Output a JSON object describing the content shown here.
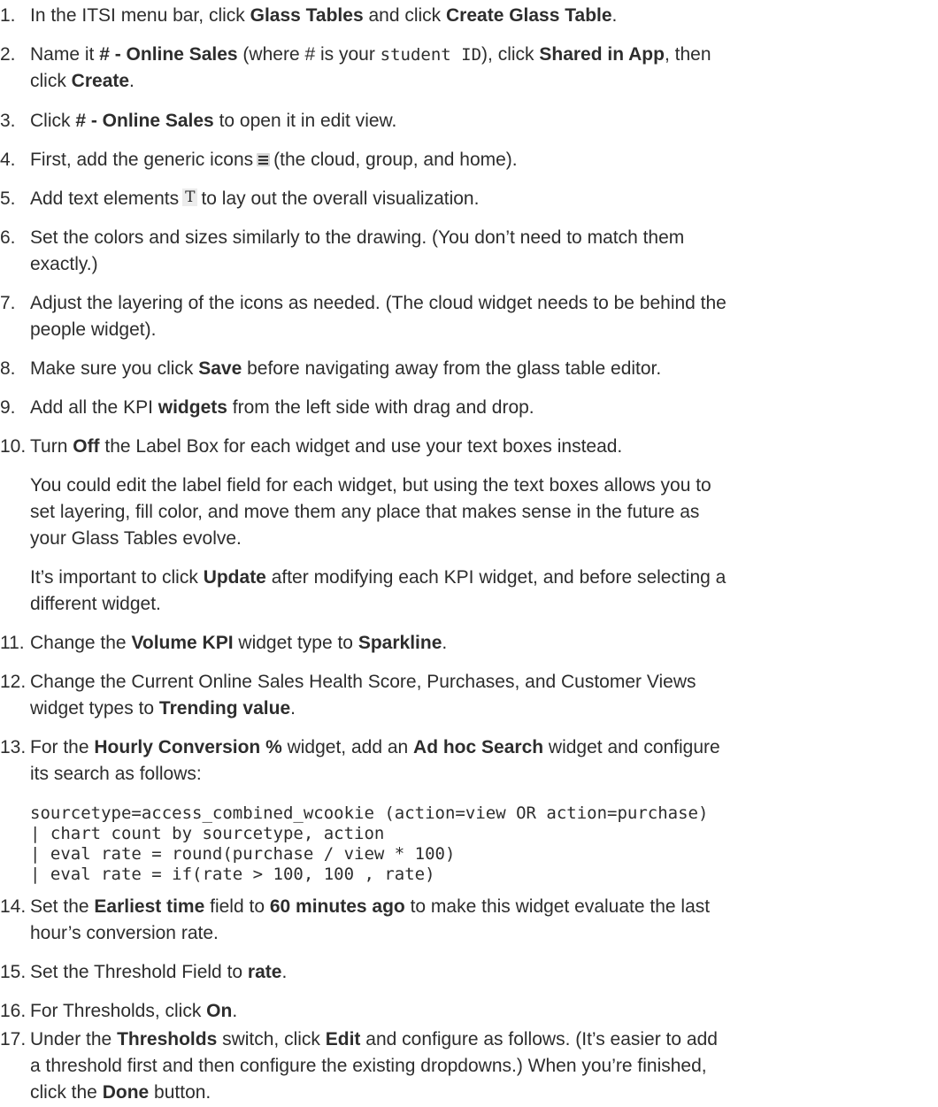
{
  "steps": [
    {
      "n": "1.",
      "parts": [
        "In the ITSI menu bar, click ",
        "Glass Tables",
        " and click ",
        "Create Glass Table",
        "."
      ]
    },
    {
      "n": "2.",
      "line1": [
        "Name it ",
        "# - Online Sales",
        " (where # is your ",
        "student ID",
        "), click ",
        "Shared in App",
        ", then"
      ],
      "line2": [
        "click ",
        "Create",
        "."
      ]
    },
    {
      "n": "3.",
      "parts": [
        "Click ",
        "# - Online Sales",
        " to open it in edit view."
      ]
    },
    {
      "n": "4.",
      "parts": [
        "First, add the generic icons",
        "(the cloud, group, and home)."
      ],
      "icon": "list-icon"
    },
    {
      "n": "5.",
      "parts": [
        "Add text elements",
        "to lay out the overall visualization."
      ],
      "icon": "text-tool-icon",
      "icon_glyph": "T"
    },
    {
      "n": "6.",
      "line1": "Set the colors and sizes similarly to the drawing. (You don’t need to match them",
      "line2": "exactly.)"
    },
    {
      "n": "7.",
      "line1": "Adjust the layering of the icons as needed. (The cloud widget needs to be behind the",
      "line2": "people widget)."
    },
    {
      "n": "8.",
      "parts": [
        "Make sure you click ",
        "Save",
        " before navigating away from the glass table editor."
      ]
    },
    {
      "n": "9.",
      "parts": [
        "Add all the KPI ",
        "widgets",
        " from the left side with drag and drop."
      ]
    },
    {
      "n": "10.",
      "parts": [
        "Turn ",
        "Off",
        " the Label Box for each widget and use your text boxes instead."
      ]
    },
    {
      "n": "11.",
      "parts": [
        "Change the ",
        "Volume KPI",
        " widget type to ",
        "Sparkline",
        "."
      ]
    },
    {
      "n": "12.",
      "line1": "Change the Current Online Sales Health Score, Purchases, and Customer Views",
      "line2": [
        "widget types to ",
        "Trending value",
        "."
      ]
    },
    {
      "n": "13.",
      "line1": [
        "For the ",
        "Hourly Conversion %",
        " widget, add an ",
        "Ad hoc Search",
        " widget and configure"
      ],
      "line2": "its search as follows:"
    },
    {
      "n": "14.",
      "line1": [
        "Set the ",
        "Earliest time",
        " field to ",
        "60 minutes ago",
        " to make this widget evaluate the last"
      ],
      "line2": "hour’s conversion rate."
    },
    {
      "n": "15.",
      "parts": [
        "Set the Threshold Field to ",
        "rate",
        "."
      ]
    },
    {
      "n": "16.",
      "parts": [
        "For Thresholds, click ",
        "On",
        "."
      ]
    },
    {
      "n": "17.",
      "line1": [
        "Under the ",
        "Thresholds",
        " switch, click ",
        "Edit",
        " and configure as follows. (It’s easier to add"
      ],
      "line2": "a threshold first and then configure the existing dropdowns.) When you’re finished,",
      "line3": [
        "click the ",
        "Done",
        " button."
      ]
    }
  ],
  "note10a": {
    "line1": "You could edit the label field for each widget, but using the text boxes allows you to",
    "line2": "set layering, fill color, and move them any place that makes sense in the future as",
    "line3": "your Glass Tables evolve."
  },
  "note10b": {
    "line1": [
      "It’s important to click ",
      "Update",
      " after modifying each KPI widget, and before selecting a"
    ],
    "line2": "different widget."
  },
  "code": {
    "line1": "sourcetype=access_combined_wcookie (action=view OR action=purchase)",
    "line2": "| chart count by sourcetype, action",
    "line3": "| eval rate = round(purchase / view * 100)",
    "line4": "| eval rate = if(rate > 100, 100 , rate)"
  }
}
